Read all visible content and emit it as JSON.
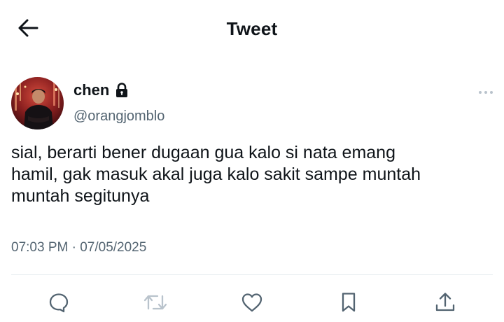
{
  "header": {
    "title": "Tweet",
    "back_icon": "arrow-left-icon"
  },
  "author": {
    "display_name": "chen",
    "handle": "@orangjomblo",
    "protected_icon": "lock-icon",
    "avatar_icon": "profile-photo"
  },
  "tweet": {
    "text": "sial, berarti bener dugaan gua kalo si nata emang\nhamil, gak masuk akal juga kalo sakit sampe muntah\nmuntah segitunya",
    "time": "07:03 PM",
    "separator": "·",
    "date": "07/05/2025"
  },
  "actions": [
    {
      "name": "reply",
      "icon": "reply-icon"
    },
    {
      "name": "retweet",
      "icon": "retweet-icon"
    },
    {
      "name": "like",
      "icon": "heart-icon"
    },
    {
      "name": "bookmark",
      "icon": "bookmark-icon"
    },
    {
      "name": "share",
      "icon": "share-icon"
    }
  ],
  "colors": {
    "text_primary": "#0f1419",
    "text_secondary": "#536471",
    "retweet_disabled": "#b9c3cc",
    "divider": "#e6ecf0"
  }
}
